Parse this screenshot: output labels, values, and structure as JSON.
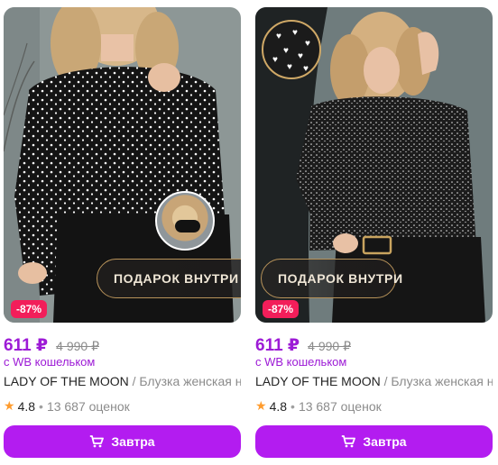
{
  "colors": {
    "accent": "#b31cf0",
    "price": "#9d1bd6",
    "discount_badge": "#f21e5a",
    "star": "#ff9c2e"
  },
  "products": [
    {
      "gift_label": "ПОДАРОК ВНУТРИ",
      "discount": "-87%",
      "price": "611 ₽",
      "old_price": "4 990 ₽",
      "wallet_note": "с WB кошельком",
      "brand": "LADY OF THE MOON",
      "name": " / Блузка женская нарядная",
      "rating": "4.8",
      "reviews": "13 687 оценок",
      "cart_label": "Завтра",
      "icons": [
        "star-icon",
        "cart-icon",
        "zoom-inset-icon"
      ]
    },
    {
      "gift_label": "ПОДАРОК ВНУТРИ",
      "discount": "-87%",
      "price": "611 ₽",
      "old_price": "4 990 ₽",
      "wallet_note": "с WB кошельком",
      "brand": "LADY OF THE MOON",
      "name": " / Блузка женская нарядная",
      "rating": "4.8",
      "reviews": "13 687 оценок",
      "cart_label": "Завтра",
      "icons": [
        "star-icon",
        "cart-icon",
        "hearts-print-icon"
      ]
    }
  ]
}
